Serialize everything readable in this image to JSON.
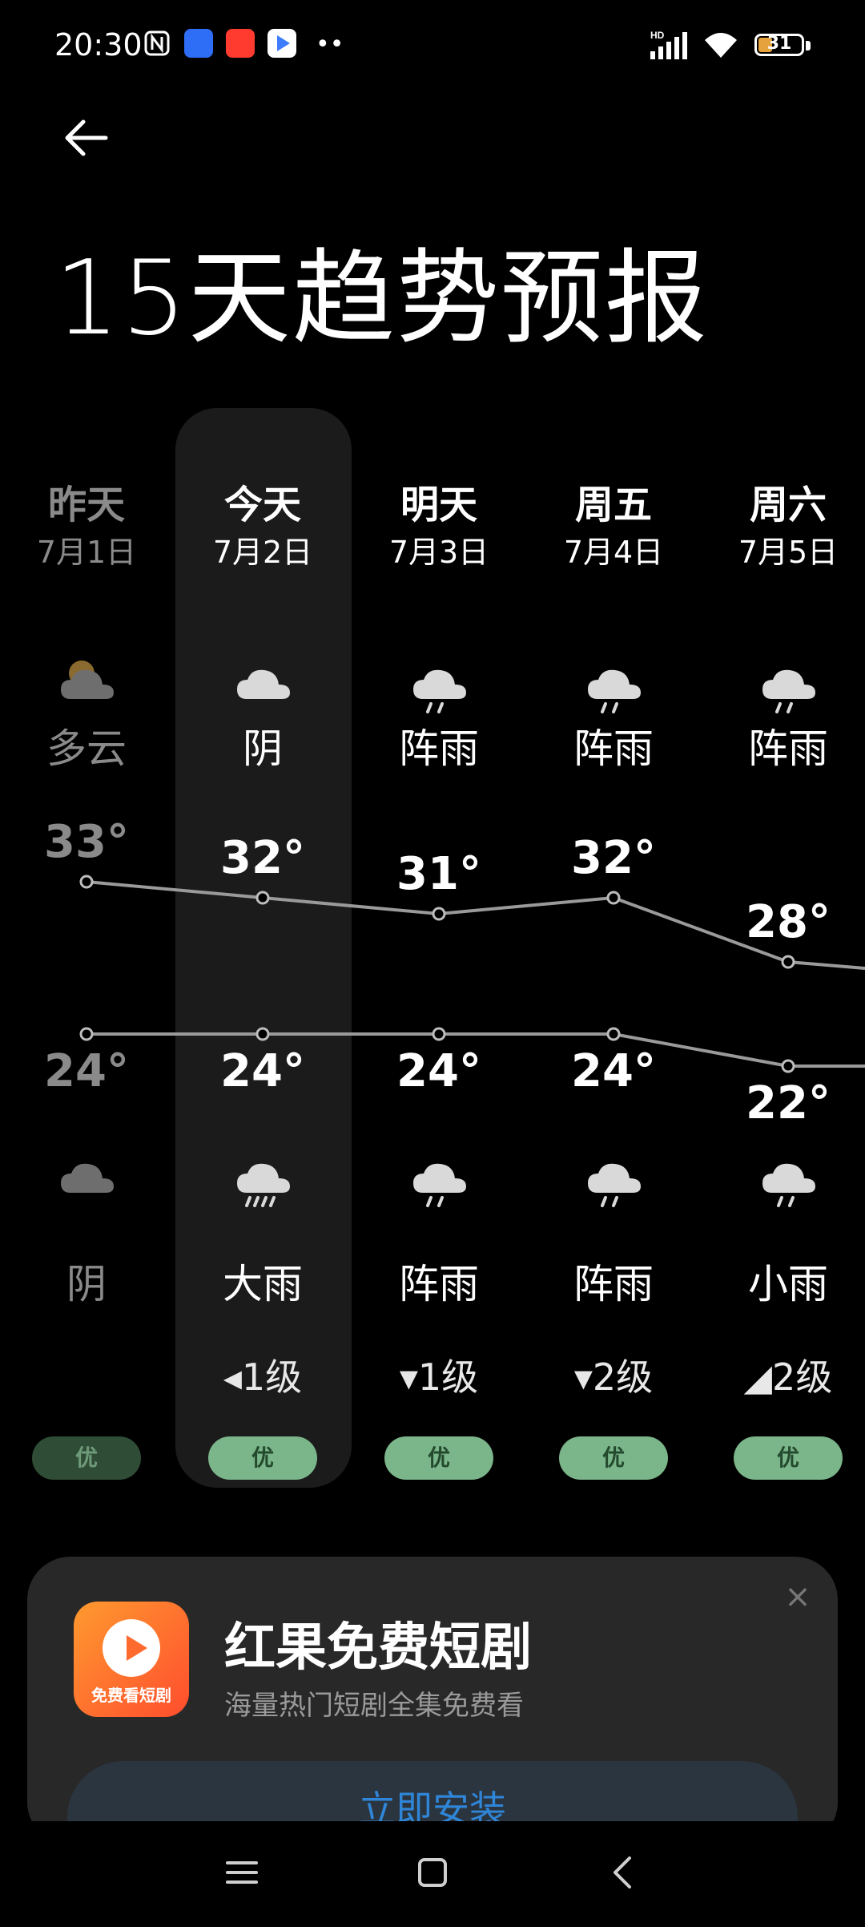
{
  "status_bar": {
    "time": "20:30",
    "signal_label": "HD",
    "battery_level": "31"
  },
  "page": {
    "title": "15天趋势预报"
  },
  "days": [
    {
      "name": "昨天",
      "date": "7月1日",
      "day_icon": "partly-cloudy-icon",
      "day_condition": "多云",
      "high": "33°",
      "low": "24°",
      "night_icon": "overcast-icon",
      "night_condition": "阴",
      "wind": "",
      "aqi": "优",
      "dim": true
    },
    {
      "name": "今天",
      "date": "7月2日",
      "day_icon": "overcast-icon",
      "day_condition": "阴",
      "high": "32°",
      "low": "24°",
      "night_icon": "heavy-rain-icon",
      "night_condition": "大雨",
      "wind": "◂1级",
      "aqi": "优",
      "dim": false
    },
    {
      "name": "明天",
      "date": "7月3日",
      "day_icon": "shower-icon",
      "day_condition": "阵雨",
      "high": "31°",
      "low": "24°",
      "night_icon": "shower-icon",
      "night_condition": "阵雨",
      "wind": "▾1级",
      "aqi": "优",
      "dim": false
    },
    {
      "name": "周五",
      "date": "7月4日",
      "day_icon": "shower-icon",
      "day_condition": "阵雨",
      "high": "32°",
      "low": "24°",
      "night_icon": "shower-icon",
      "night_condition": "阵雨",
      "wind": "▾2级",
      "aqi": "优",
      "dim": false
    },
    {
      "name": "周六",
      "date": "7月5日",
      "day_icon": "shower-icon",
      "day_condition": "阵雨",
      "high": "28°",
      "low": "22°",
      "night_icon": "light-rain-icon",
      "night_condition": "小雨",
      "wind": "◢2级",
      "aqi": "优",
      "dim": false
    }
  ],
  "temperature_trend": {
    "highs": [
      33,
      32,
      31,
      32,
      28
    ],
    "lows": [
      24,
      24,
      24,
      24,
      22
    ]
  },
  "ad": {
    "logo_text": "免费看短剧",
    "title": "红果免费短剧",
    "subtitle": "海量热门短剧全集免费看",
    "install_label": "立即安装",
    "close_icon": "close-icon"
  },
  "colors": {
    "aqi_good": "#7bb58a",
    "accent_blue": "#2f86d8",
    "battery": "#e6a23c"
  }
}
